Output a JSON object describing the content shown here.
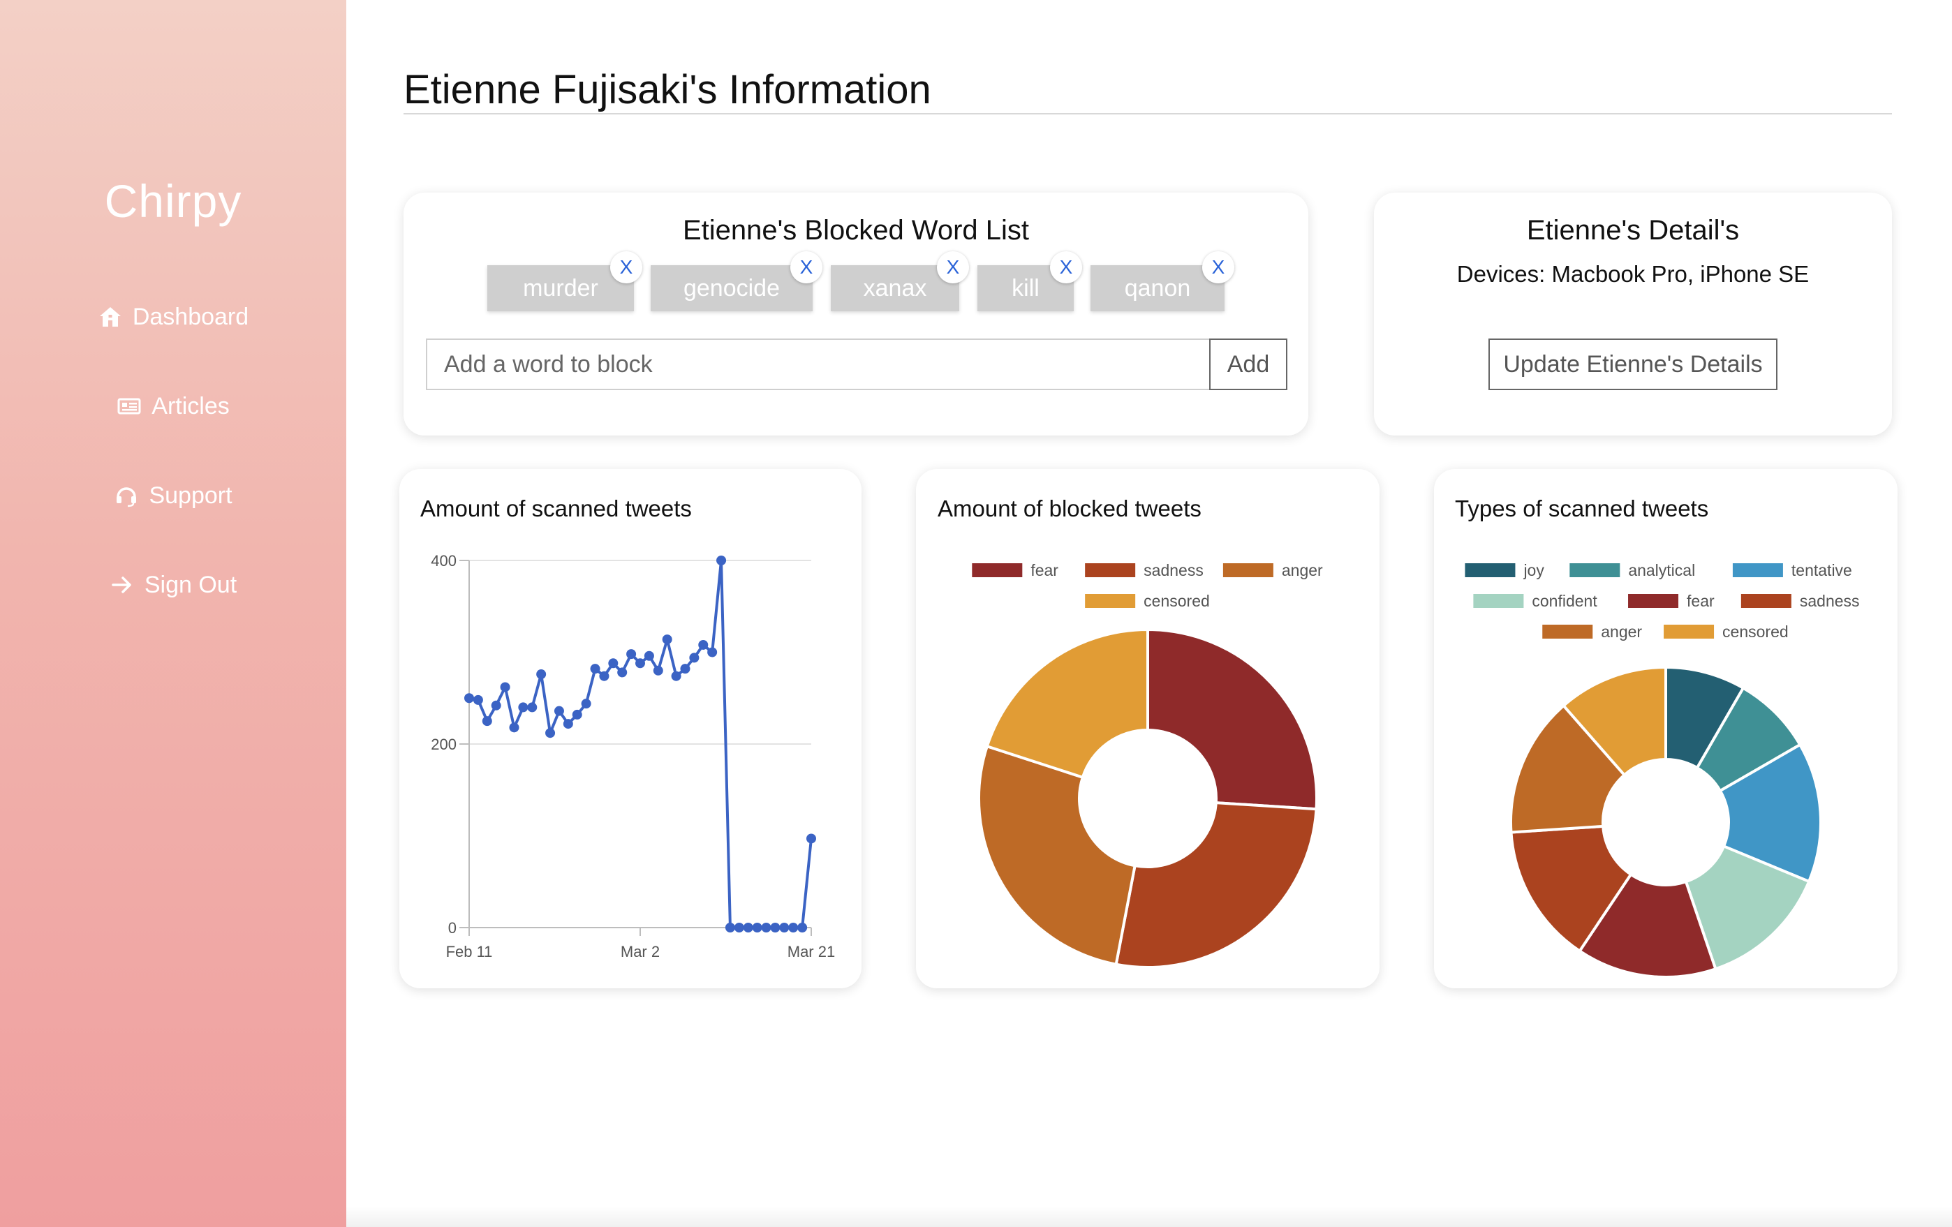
{
  "sidebar": {
    "brand": "Chirpy",
    "items": [
      {
        "label": "Dashboard",
        "icon": "home-icon"
      },
      {
        "label": "Articles",
        "icon": "newspaper-icon"
      },
      {
        "label": "Support",
        "icon": "headset-icon"
      },
      {
        "label": "Sign Out",
        "icon": "arrow-right-icon"
      }
    ]
  },
  "header": {
    "title": "Etienne Fujisaki's Information"
  },
  "blocked_words": {
    "title": "Etienne's Blocked Word List",
    "words": [
      "murder",
      "genocide",
      "xanax",
      "kill",
      "qanon"
    ],
    "remove_label": "X",
    "input_placeholder": "Add a word to block",
    "input_value": "",
    "add_label": "Add"
  },
  "details": {
    "title": "Etienne's Detail's",
    "devices": "Devices: Macbook Pro, iPhone SE",
    "update_label": "Update Etienne's Details"
  },
  "colors": {
    "line": "#3b63c4",
    "joy": "#235f72",
    "analytical": "#3f9095",
    "tentative": "#4096c6",
    "confident": "#a4d3c1",
    "fear": "#8f2a2a",
    "sadness": "#ab431f",
    "anger": "#be6a26",
    "censored": "#e19c35"
  },
  "chart_data": [
    {
      "type": "line",
      "title": "Amount of scanned tweets",
      "x_ticks": [
        "Feb 11",
        "Mar 2",
        "Mar 21"
      ],
      "x": [
        "Feb 11",
        "Feb 12",
        "Feb 13",
        "Feb 14",
        "Feb 15",
        "Feb 16",
        "Feb 17",
        "Feb 18",
        "Feb 19",
        "Feb 20",
        "Feb 21",
        "Feb 22",
        "Feb 23",
        "Feb 24",
        "Feb 25",
        "Feb 26",
        "Feb 27",
        "Feb 28",
        "Mar 1",
        "Mar 2",
        "Mar 3",
        "Mar 4",
        "Mar 5",
        "Mar 6",
        "Mar 7",
        "Mar 8",
        "Mar 9",
        "Mar 10",
        "Mar 11",
        "Mar 12",
        "Mar 13",
        "Mar 14",
        "Mar 15",
        "Mar 16",
        "Mar 17",
        "Mar 18",
        "Mar 19",
        "Mar 20",
        "Mar 21"
      ],
      "values": [
        250,
        248,
        225,
        242,
        262,
        218,
        240,
        240,
        276,
        212,
        236,
        222,
        232,
        244,
        282,
        274,
        288,
        278,
        298,
        288,
        296,
        280,
        314,
        274,
        282,
        294,
        308,
        300,
        400,
        0,
        0,
        0,
        0,
        0,
        0,
        0,
        0,
        0,
        97
      ],
      "y_ticks": [
        0,
        200,
        400
      ],
      "ylim": [
        0,
        400
      ],
      "grid": true,
      "legend": false
    },
    {
      "type": "pie",
      "donut": true,
      "title": "Amount of blocked tweets",
      "legend": "top",
      "labels": [
        "fear",
        "sadness",
        "anger",
        "censored"
      ],
      "values": [
        26,
        27,
        27,
        20
      ]
    },
    {
      "type": "pie",
      "donut": true,
      "title": "Types of scanned tweets",
      "legend": "top",
      "labels": [
        "joy",
        "analytical",
        "tentative",
        "confident",
        "fear",
        "sadness",
        "anger",
        "censored"
      ],
      "values": [
        8,
        8,
        14,
        13,
        14,
        14,
        14,
        11
      ]
    }
  ]
}
